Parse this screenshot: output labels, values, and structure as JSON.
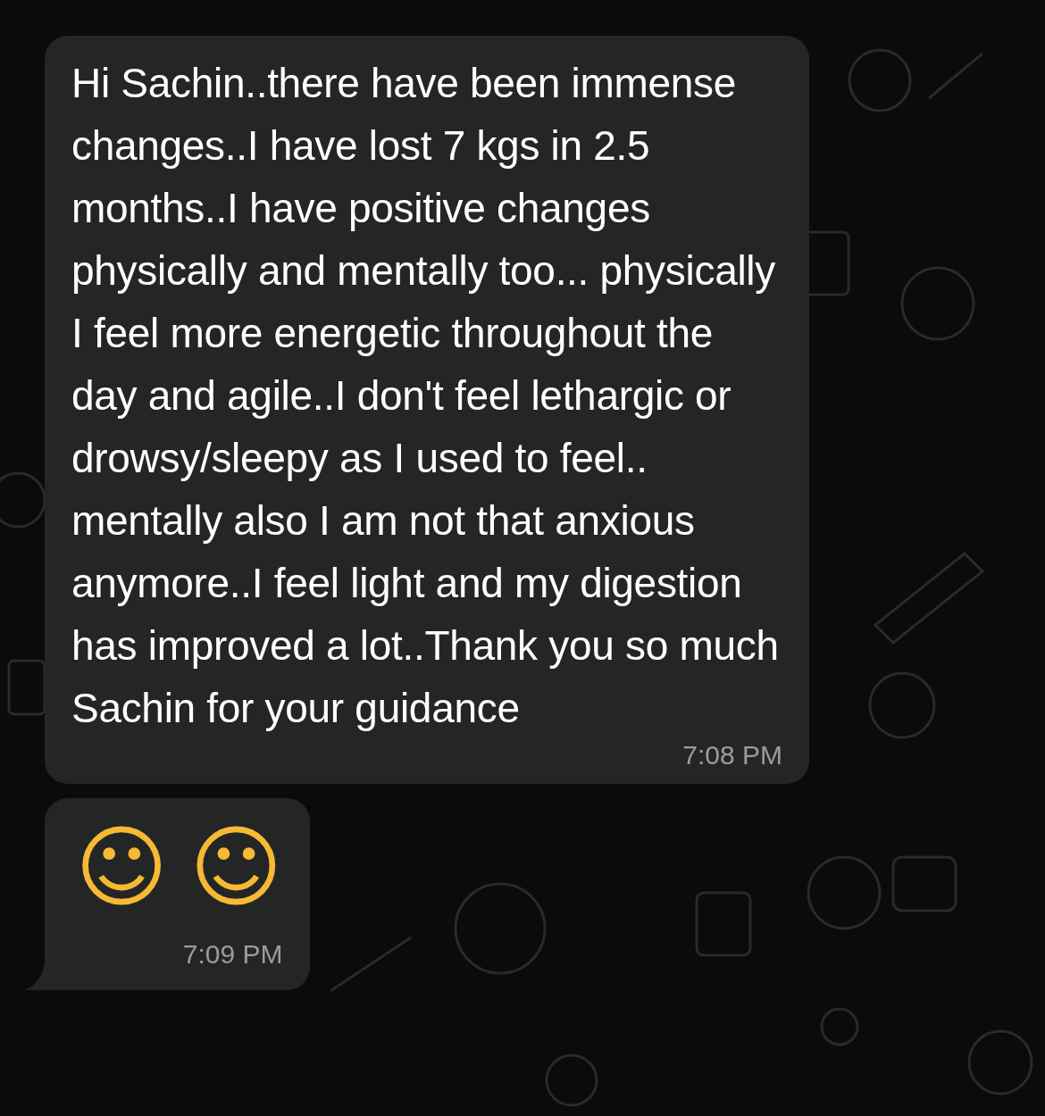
{
  "messages": [
    {
      "kind": "text",
      "text": "Hi Sachin..there have been immense changes..I have lost 7 kgs in 2.5 months..I have positive changes physically and mentally too... physically I feel more energetic throughout the day and agile..I don't feel lethargic or drowsy/sleepy as I used to feel.. mentally also I am not that anxious anymore..I feel light and my digestion has improved a lot..Thank you so much Sachin for your guidance",
      "time": "7:08 PM",
      "tail": false
    },
    {
      "kind": "emoji",
      "emojis": [
        "☺",
        "☺"
      ],
      "time": "7:09 PM",
      "tail": true
    }
  ]
}
